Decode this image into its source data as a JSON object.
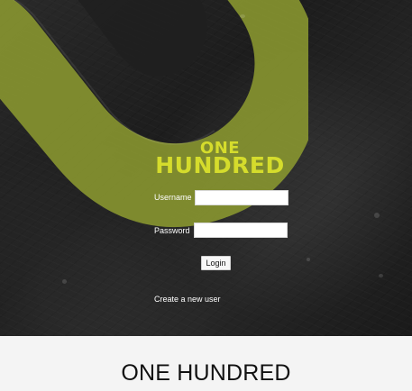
{
  "brand": {
    "logo_line_1": "ONE",
    "logo_line_2": "HUNDRED",
    "accent_color": "#d5dc2c"
  },
  "login_form": {
    "username_label": "Username",
    "username_value": "",
    "password_label": "Password",
    "password_value": "",
    "login_button": "Login",
    "create_user_link": "Create a new user"
  },
  "caption": {
    "title": "ONE HUNDRED"
  },
  "icons": {
    "logo_shape": "stylized-u-logo-shape"
  }
}
